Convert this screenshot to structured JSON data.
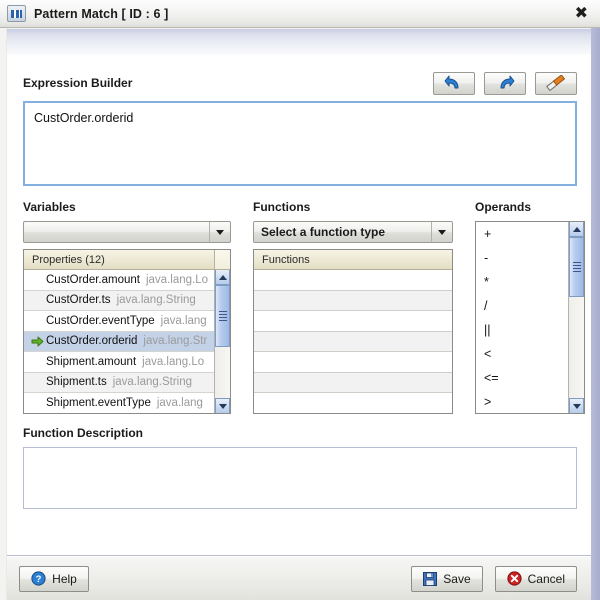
{
  "window": {
    "title": "Pattern Match [ ID : 6 ]",
    "icon": "application-window-icon",
    "close_label": "✖"
  },
  "expression": {
    "label": "Expression Builder",
    "value": "CustOrder.orderid",
    "tools": [
      {
        "name": "undo-button",
        "title": "Undo"
      },
      {
        "name": "redo-button",
        "title": "Redo"
      },
      {
        "name": "clear-button",
        "title": "Clear"
      }
    ]
  },
  "variables": {
    "label": "Variables",
    "dropdown_value": "",
    "list_header": "Properties (12)",
    "rows": [
      {
        "name": "CustOrder.amount",
        "type": "java.lang.Lo",
        "selected": false
      },
      {
        "name": "CustOrder.ts",
        "type": "java.lang.String",
        "selected": false
      },
      {
        "name": "CustOrder.eventType",
        "type": "java.lang",
        "selected": false
      },
      {
        "name": "CustOrder.orderid",
        "type": "java.lang.Str",
        "selected": true
      },
      {
        "name": "Shipment.amount",
        "type": "java.lang.Lo",
        "selected": false
      },
      {
        "name": "Shipment.ts",
        "type": "java.lang.String",
        "selected": false
      },
      {
        "name": "Shipment.eventType",
        "type": "java.lang",
        "selected": false
      }
    ]
  },
  "functions": {
    "label": "Functions",
    "dropdown_value": "Select a function type",
    "list_header": "Functions",
    "rows": [
      "",
      "",
      "",
      "",
      "",
      "",
      ""
    ]
  },
  "operands": {
    "label": "Operands",
    "items": [
      "+",
      "-",
      "*",
      "/",
      "||",
      "<",
      "<=",
      ">"
    ]
  },
  "function_description": {
    "label": "Function Description",
    "value": ""
  },
  "footer": {
    "help_label": "Help",
    "save_label": "Save",
    "cancel_label": "Cancel"
  },
  "colors": {
    "accent_blue": "#2b62b0",
    "focus_border": "#83b0e0",
    "selection": "#c4d2e8",
    "list_header": "#ece7d2",
    "cancel_red": "#cc2222",
    "edge": "#a8acce"
  }
}
